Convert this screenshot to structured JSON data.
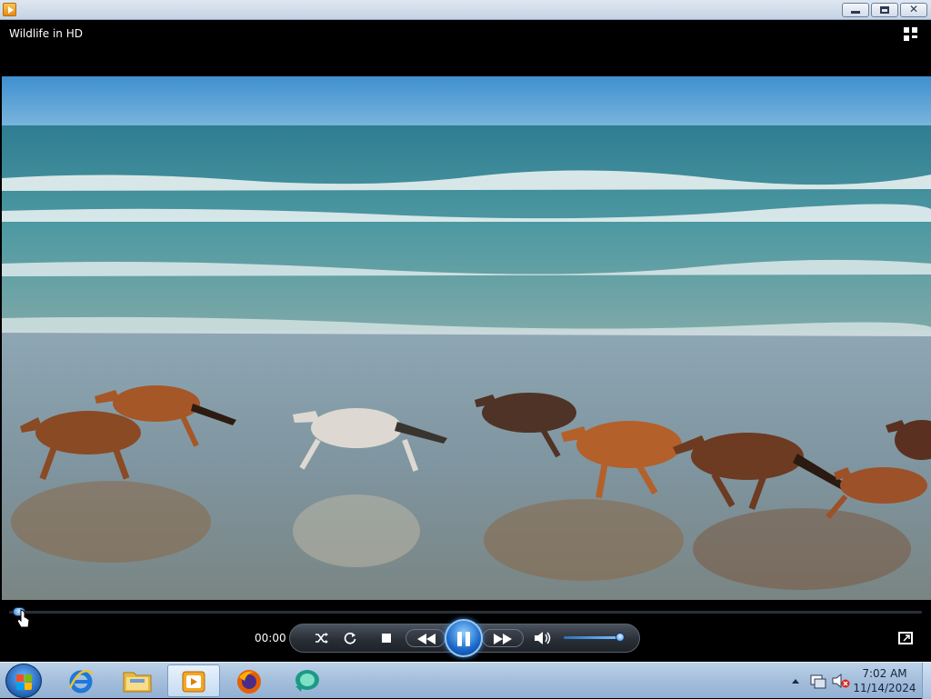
{
  "window": {
    "close_label": "✕"
  },
  "player": {
    "media_title": "Wildlife in HD",
    "current_time": "00:00",
    "seek_progress": 0.005,
    "volume_level": 0.93,
    "state": "playing"
  },
  "icons": {
    "app": "media-player-icon",
    "switch_to_library": "switch-to-library-icon",
    "shuffle": "shuffle-icon",
    "repeat": "repeat-icon",
    "stop": "stop-icon",
    "previous": "rewind-icon",
    "pause": "pause-icon",
    "next": "fast-forward-icon",
    "mute": "speaker-icon",
    "fullscreen": "fullscreen-icon"
  },
  "taskbar": {
    "items": [
      "start-button",
      "internet-explorer",
      "windows-explorer",
      "windows-media-player",
      "firefox",
      "app-icon"
    ],
    "active_item": "windows-media-player"
  },
  "tray": {
    "time": "7:02 AM",
    "date": "11/14/2024"
  }
}
